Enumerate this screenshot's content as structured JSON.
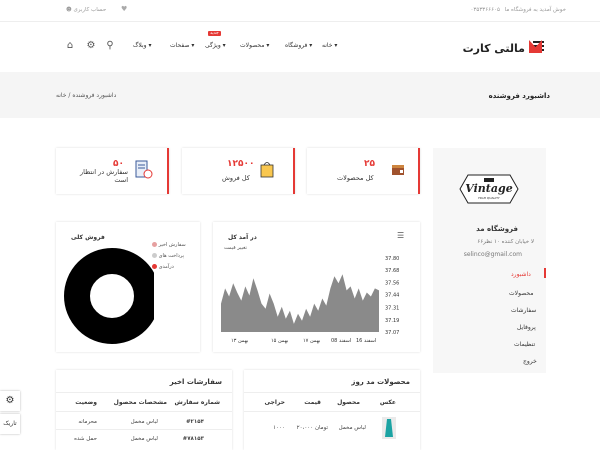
{
  "topbar": {
    "welcome": "خوش آمدید به فروشگاه ما",
    "phone": "۰۳۵۳۳۶۶۶۰۵",
    "account": "حساب کاربری"
  },
  "logo": {
    "text": "مالتی کارت"
  },
  "menu": [
    {
      "label": "خانه"
    },
    {
      "label": "فروشگاه"
    },
    {
      "label": "محصولات"
    },
    {
      "label": "ویژگی",
      "badge": "جدید"
    },
    {
      "label": "صفحات"
    },
    {
      "label": "وبلاگ"
    }
  ],
  "breadcrumb": {
    "title": "داشبورد فروشنده",
    "home": "خانه",
    "sep": "/",
    "current": "داشبورد فروشنده"
  },
  "stats": {
    "products": {
      "value": "۲۵",
      "label": "کل محصولات"
    },
    "sales": {
      "value": "۱۲۵۰۰",
      "label": "کل فروش"
    },
    "orders": {
      "value": "۵۰",
      "label": "سفارش در انتظار است"
    }
  },
  "sidebar": {
    "store_name": "فروشگاه مد",
    "address": "۶۶لا خیابان کننده ۱۰ نظر",
    "email": "selinco@gmail.com",
    "items": [
      {
        "label": "داشبورد"
      },
      {
        "label": "محصولات"
      },
      {
        "label": "سفارشات"
      },
      {
        "label": "پروفایل"
      },
      {
        "label": "تنظیمات"
      },
      {
        "label": "خروج"
      }
    ]
  },
  "line_chart": {
    "title": "در آمد کل",
    "subtitle": "تغییر قیمت"
  },
  "donut_chart": {
    "title": "فروش کلی",
    "legend": [
      "سفارش اخیر",
      "پرداخت های",
      "درآمدی"
    ]
  },
  "chart_data": [
    {
      "type": "area",
      "title": "در آمد کل",
      "x_ticks": [
        "بهمن ۱۳",
        "بهمن ۱۵",
        "بهمن ۱۷",
        "اسفند 08",
        "اسفند 16"
      ],
      "y_ticks": [
        37.07,
        37.19,
        37.31,
        37.44,
        37.56,
        37.68,
        37.8
      ],
      "ylim": [
        37.07,
        37.8
      ],
      "values": [
        37.35,
        37.5,
        37.42,
        37.55,
        37.46,
        37.38,
        37.52,
        37.43,
        37.6,
        37.48,
        37.35,
        37.3,
        37.45,
        37.35,
        37.22,
        37.32,
        37.2,
        37.28,
        37.15,
        37.25,
        37.18,
        37.3,
        37.22,
        37.35,
        37.28,
        37.4,
        37.33,
        37.5,
        37.62,
        37.55,
        37.64,
        37.48,
        37.52,
        37.4,
        37.5,
        37.38,
        37.46,
        37.42,
        37.5,
        37.48
      ],
      "grid": false
    },
    {
      "type": "pie",
      "title": "فروش کلی",
      "categories": [
        "سفارش اخیر",
        "پرداخت های",
        "درآمدی"
      ],
      "values": [
        100,
        0,
        0
      ]
    }
  ],
  "recent_orders": {
    "title": "سفارشات اخیر",
    "headers": [
      "شماره سفارش",
      "مشخصات محصول",
      "وضعیت"
    ],
    "rows": [
      {
        "id": "#۲۱۵۴",
        "product": "لباس مخمل",
        "status": "محرمانه"
      },
      {
        "id": "#۷۸۱۵۳",
        "product": "لباس مخمل",
        "status": "حمل شده"
      }
    ]
  },
  "top_products": {
    "title": "محصولات مد روز",
    "headers": [
      "عکس",
      "محصول",
      "قیمت",
      "حراجی"
    ],
    "rows": [
      {
        "product": "لباس مخمل",
        "price": "۲۰،۰۰۰ تومان",
        "sale": "۱۰۰۰"
      }
    ]
  },
  "floating": {
    "dark": "تاریک"
  }
}
